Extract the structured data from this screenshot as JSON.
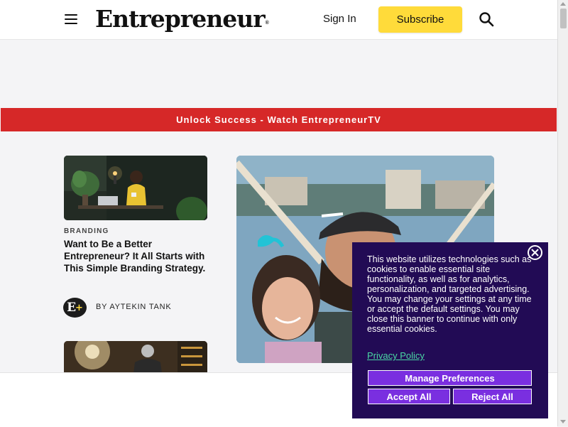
{
  "header": {
    "logo": "Entrepreneur",
    "logo_mark": "®",
    "menu_icon": "hamburger-menu-icon",
    "signin_label": "Sign In",
    "subscribe_label": "Subscribe",
    "search_icon": "search-icon",
    "accent_color": "#ffdb3a"
  },
  "banner": {
    "text": "Unlock Success - Watch EntrepreneurTV",
    "color": "#d62828"
  },
  "articles": [
    {
      "category": "BRANDING",
      "headline": "Want to Be a Better Entrepreneur? It All Starts with This Simple Branding Strategy.",
      "author": "BY AYTEKIN TANK",
      "author_avatar_text": "E",
      "author_avatar_plus": "+"
    }
  ],
  "cookie_banner": {
    "text": "This website utilizes technologies such as cookies to enable essential site functionality, as well as for analytics, personalization, and targeted advertising. You may change your settings at any time or accept the default settings. You may close this banner to continue with only essential cookies.",
    "privacy_link": "Privacy Policy",
    "manage_label": "Manage Preferences",
    "accept_label": "Accept All",
    "reject_label": "Reject All",
    "background": "#220b55",
    "button_color": "#7a2fe0",
    "link_color": "#4ad8a4"
  }
}
